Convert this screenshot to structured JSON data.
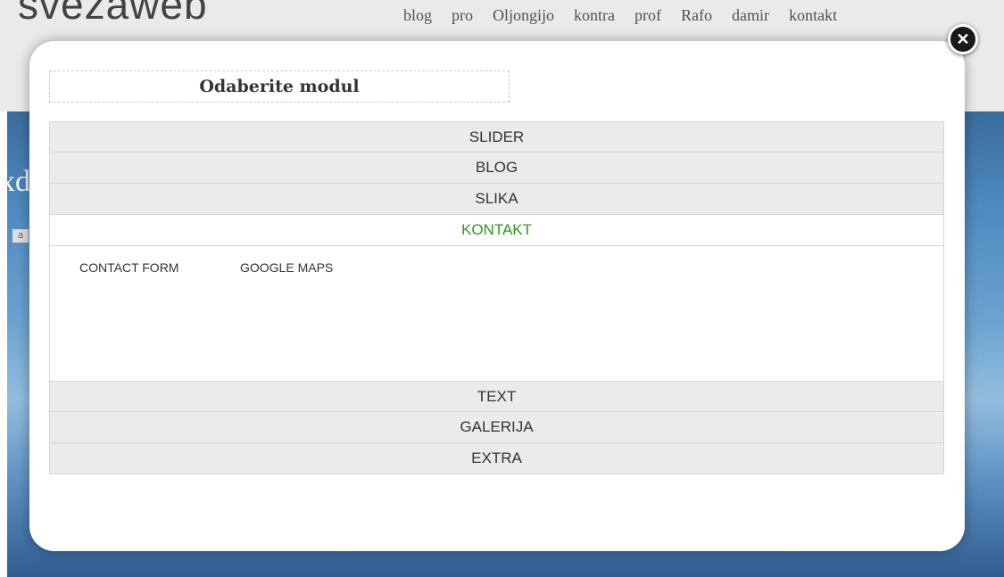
{
  "site": {
    "logo": "svezaweb",
    "nav": [
      "blog",
      "pro",
      "Oljongijo",
      "kontra",
      "prof",
      "Rafo",
      "damir",
      "kontakt"
    ],
    "hero_fragment": "xd",
    "hero_button": "a"
  },
  "modal": {
    "title": "Odaberite modul",
    "close_icon": "close-icon",
    "sections": [
      {
        "label": "SLIDER",
        "active": false
      },
      {
        "label": "BLOG",
        "active": false
      },
      {
        "label": "SLIKA",
        "active": false
      },
      {
        "label": "KONTAKT",
        "active": true,
        "items": [
          "CONTACT FORM",
          "GOOGLE MAPS"
        ]
      },
      {
        "label": "TEXT",
        "active": false
      },
      {
        "label": "GALERIJA",
        "active": false
      },
      {
        "label": "EXTRA",
        "active": false
      }
    ]
  },
  "colors": {
    "active_section": "#2a9a1e",
    "section_bg": "#ebebeb",
    "hero_blue": "#3f7fba"
  }
}
